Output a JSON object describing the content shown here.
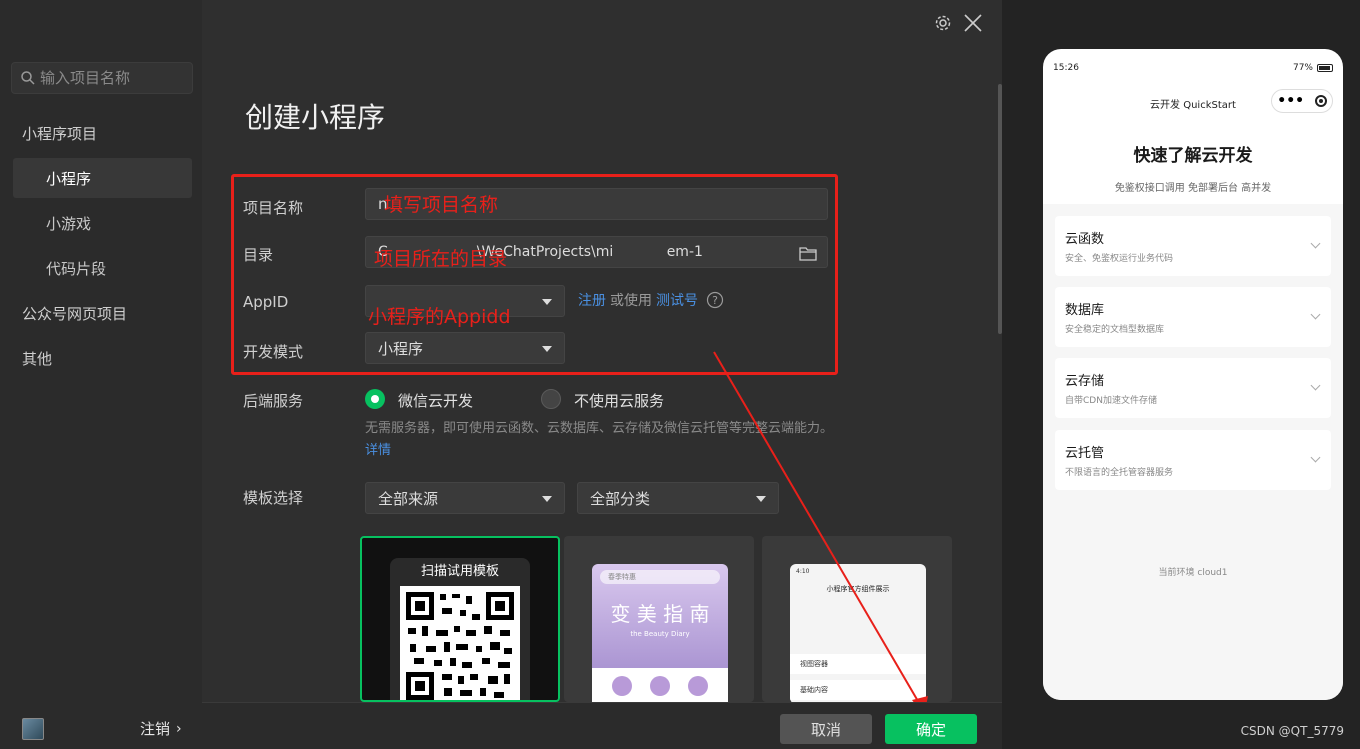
{
  "sidebar": {
    "search_placeholder": "输入项目名称",
    "section_miniprogram": "小程序项目",
    "items": [
      "小程序",
      "小游戏",
      "代码片段"
    ],
    "section_web": "公众号网页项目",
    "section_other": "其他",
    "logout": "注销"
  },
  "main": {
    "title": "创建小程序",
    "form": {
      "name_label": "项目名称",
      "name_value": "n",
      "dir_label": "目录",
      "dir_value": "C                    \\WeChatProjects\\mi            em-1",
      "appid_label": "AppID",
      "appid_register": "注册",
      "appid_or": "或使用",
      "appid_test": "测试号",
      "mode_label": "开发模式",
      "mode_value": "小程序",
      "backend_label": "后端服务",
      "backend_opt1": "微信云开发",
      "backend_opt2": "不使用云服务",
      "backend_desc": "无需服务器，即可使用云函数、云数据库、云存储及微信云托管等完整云端能力。",
      "backend_detail": "详情",
      "template_label": "模板选择",
      "template_source": "全部来源",
      "template_category": "全部分类"
    },
    "annotations": {
      "name": "填写项目名称",
      "dir": "项目所在的目录",
      "appid": "小程序的Appidd"
    },
    "cards": {
      "scan_label": "扫描试用模板",
      "card2_title": "变 美 指 南",
      "card2_search": "春季特惠",
      "card2_subtitle": "the Beauty Diary",
      "card3_time": "4:10",
      "card3_title": "小程序官方组件展示",
      "card3_row1": "视图容器",
      "card3_row2": "基础内容"
    },
    "buttons": {
      "cancel": "取消",
      "confirm": "确定"
    }
  },
  "preview": {
    "time": "15:26",
    "battery": "77%",
    "nav_title": "云开发 QuickStart",
    "heading": "快速了解云开发",
    "subheading": "免鉴权接口调用 免部署后台 高并发",
    "items": [
      {
        "title": "云函数",
        "desc": "安全、免鉴权运行业务代码"
      },
      {
        "title": "数据库",
        "desc": "安全稳定的文档型数据库"
      },
      {
        "title": "云存储",
        "desc": "自带CDN加速文件存储"
      },
      {
        "title": "云托管",
        "desc": "不限语言的全托管容器服务"
      }
    ],
    "env": "当前环境 cloud1"
  },
  "watermark": "CSDN @QT_5779",
  "colors": {
    "accent": "#07c160",
    "annotation": "#e8201a",
    "link": "#4a90e2"
  }
}
